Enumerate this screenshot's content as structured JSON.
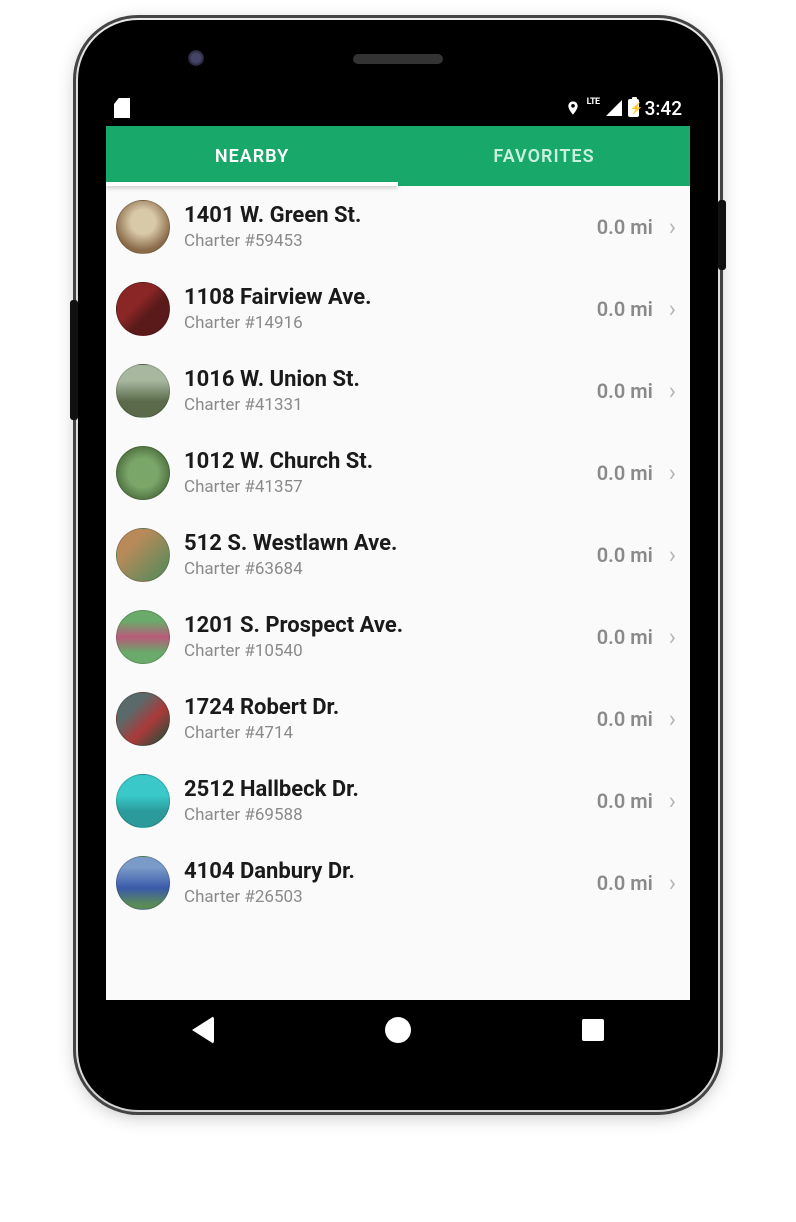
{
  "status": {
    "time": "3:42",
    "lte": "LTE"
  },
  "tabs": {
    "nearby": "NEARBY",
    "favorites": "FAVORITES",
    "active": "nearby"
  },
  "items": [
    {
      "title": "1401 W. Green St.",
      "sub": "Charter #59453",
      "dist": "0.0 mi"
    },
    {
      "title": "1108 Fairview Ave.",
      "sub": "Charter #14916",
      "dist": "0.0 mi"
    },
    {
      "title": "1016 W. Union St.",
      "sub": "Charter #41331",
      "dist": "0.0 mi"
    },
    {
      "title": "1012 W. Church St.",
      "sub": "Charter #41357",
      "dist": "0.0 mi"
    },
    {
      "title": "512 S. Westlawn Ave.",
      "sub": "Charter #63684",
      "dist": "0.0 mi"
    },
    {
      "title": "1201 S. Prospect Ave.",
      "sub": "Charter #10540",
      "dist": "0.0 mi"
    },
    {
      "title": "1724 Robert Dr.",
      "sub": "Charter #4714",
      "dist": "0.0 mi"
    },
    {
      "title": "2512 Hallbeck Dr.",
      "sub": "Charter #69588",
      "dist": "0.0 mi"
    },
    {
      "title": "4104 Danbury Dr.",
      "sub": "Charter #26503",
      "dist": "0.0 mi"
    }
  ]
}
